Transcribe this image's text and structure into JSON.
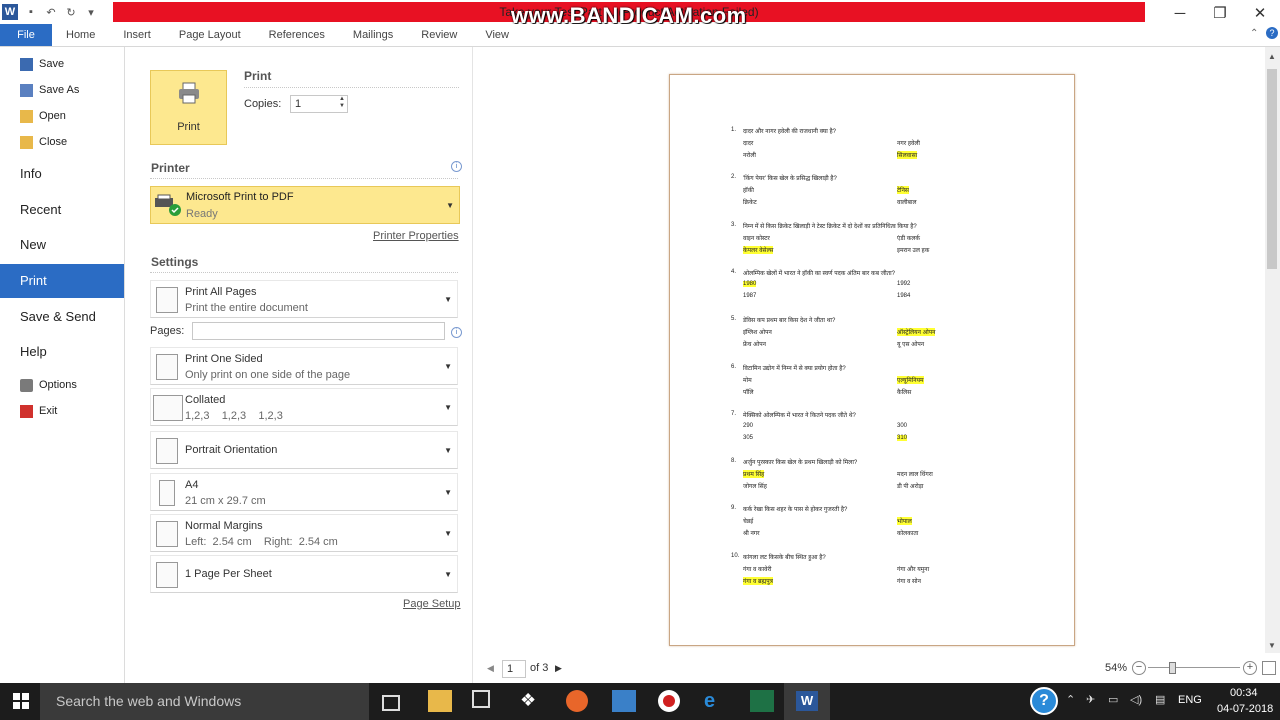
{
  "titlebar": {
    "banner_text": "Take your Test Part ... (Product Activation Failed)",
    "watermark": "www.BANDICAM.com",
    "minimize": "─",
    "restore": "❐",
    "close": "✕"
  },
  "ribbon": {
    "tabs": [
      {
        "label": "File"
      },
      {
        "label": "Home"
      },
      {
        "label": "Insert"
      },
      {
        "label": "Page Layout"
      },
      {
        "label": "References"
      },
      {
        "label": "Mailings"
      },
      {
        "label": "Review"
      },
      {
        "label": "View"
      }
    ]
  },
  "backstage": {
    "small_items": [
      {
        "label": "Save"
      },
      {
        "label": "Save As"
      },
      {
        "label": "Open"
      },
      {
        "label": "Close"
      }
    ],
    "big_items": [
      {
        "label": "Info"
      },
      {
        "label": "Recent"
      },
      {
        "label": "New"
      },
      {
        "label": "Print"
      },
      {
        "label": "Save & Send"
      },
      {
        "label": "Help"
      }
    ],
    "bottom_items": [
      {
        "label": "Options"
      },
      {
        "label": "Exit"
      }
    ]
  },
  "print": {
    "heading": "Print",
    "button_label": "Print",
    "copies_label": "Copies:",
    "copies_value": "1",
    "printer_heading": "Printer",
    "printer_name": "Microsoft Print to PDF",
    "printer_status": "Ready",
    "printer_properties": "Printer Properties",
    "settings_heading": "Settings",
    "pages_label": "Pages:",
    "pages_value": "",
    "settings": [
      {
        "title": "Print All Pages",
        "sub": "Print the entire document"
      },
      {
        "title": "Print One Sided",
        "sub": "Only print on one side of the page"
      },
      {
        "title": "Collated",
        "sub": "1,2,3    1,2,3    1,2,3"
      },
      {
        "title": "Portrait Orientation",
        "sub": ""
      },
      {
        "title": "A4",
        "sub": "21 cm x 29.7 cm"
      },
      {
        "title": "Normal Margins",
        "sub": "Left:  2.54 cm    Right:  2.54 cm"
      },
      {
        "title": "1 Page Per Sheet",
        "sub": ""
      }
    ],
    "page_setup": "Page Setup"
  },
  "preview": {
    "questions": [
      {
        "num": "1.",
        "text": "दादर और नागर हवेली की राजधानी क्या है?",
        "opts": [
          "दादर",
          "नगर हवेली",
          "नरोली",
          "सिलवासा"
        ],
        "hl": [
          3
        ]
      },
      {
        "num": "2.",
        "text": "'किंग पेयर' किस खेल के प्रसिद्ध खिलाड़ी है?",
        "opts": [
          "हॉकी",
          "टेनिस",
          "क्रिकेट",
          "वालीबाल"
        ],
        "hl": [
          1
        ]
      },
      {
        "num": "3.",
        "text": "निम्न में से किस क्रिकेट खिलाड़ी ने टेस्ट क्रिकेट में दो देशों का प्रतिनिधित्व किया है?",
        "opts": [
          "वाइन कोस्टर",
          "एंडी कलर्क",
          "केपलर वेसेल्स",
          "इमरान उल हक"
        ],
        "hl": [
          2
        ]
      },
      {
        "num": "4.",
        "text": "ओलम्पिक खेलों में भारत ने हॉकी का स्वर्ण पदक अंतिम बार कब जीता?",
        "opts": [
          "1980",
          "1992",
          "1987",
          "1984"
        ],
        "hl": [
          0
        ]
      },
      {
        "num": "5.",
        "text": "डेविस कप प्रथम बार किस देश ने जीता था?",
        "opts": [
          "इंग्लिश ओपन",
          "ऑस्ट्रेलियन ओपन",
          "फ्रेंच ओपन",
          "यू एस ओपन"
        ],
        "hl": [
          1
        ]
      },
      {
        "num": "6.",
        "text": "विटामिन उद्योग में निम्न में से क्या प्रयोग होता है?",
        "opts": [
          "मोम",
          "एल्यूमिनियम",
          "पॉलि",
          "कैलिस"
        ],
        "hl": [
          1
        ]
      },
      {
        "num": "7.",
        "text": "मेक्सिको ओलम्पिक में भारत ने कितने पदक जीते थे?",
        "opts": [
          "290",
          "300",
          "305",
          "310"
        ],
        "hl": [
          3
        ]
      },
      {
        "num": "8.",
        "text": "अर्जुन पुरस्कार किस खेल के प्रथम खिलाड़ी को मिला?",
        "opts": [
          "प्रथम सिंह",
          "मदन लाल धिंगरा",
          "जोगल सिंह",
          "डी पी अरोड़ा"
        ],
        "hl": [
          0
        ]
      },
      {
        "num": "9.",
        "text": "कर्क रेखा किस शहर के पास से होकर गुजरती है?",
        "opts": [
          "चेन्नई",
          "भोपाल",
          "श्री नगर",
          "कोलकाता"
        ],
        "hl": [
          1
        ]
      },
      {
        "num": "10.",
        "text": "कांगला लट किसके बीच स्थित हुआ है?",
        "opts": [
          "गंगा व कावेरी",
          "गंगा और यमुना",
          "गंगा व ब्रह्मपुत्र",
          "गंगा व सोन"
        ],
        "hl": [
          2
        ]
      }
    ],
    "page_current": "1",
    "page_of": "of 3",
    "zoom": "54%"
  },
  "taskbar": {
    "search_placeholder": "Search the web and Windows",
    "lang": "ENG",
    "time": "00:34",
    "date": "04-07-2018",
    "help": "?"
  }
}
